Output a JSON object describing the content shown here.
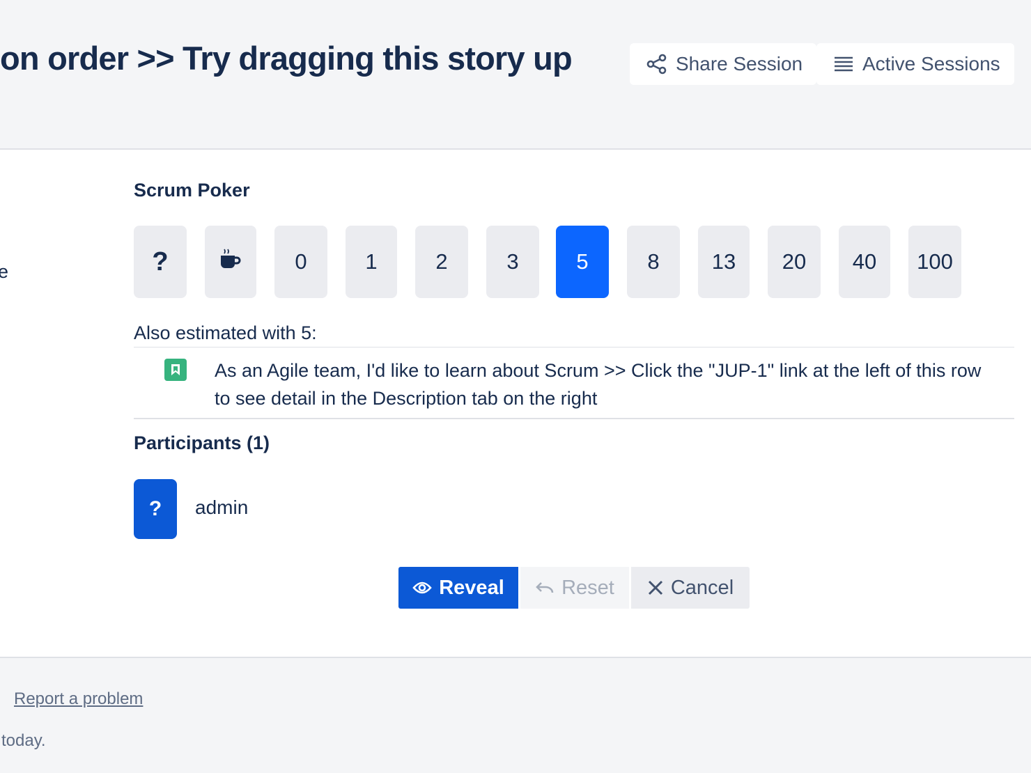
{
  "header": {
    "title": "on order >> Try dragging this story up",
    "share_label": "Share Session",
    "active_label": "Active Sessions"
  },
  "main": {
    "edge_text": "e",
    "poker_title": "Scrum Poker",
    "cards": [
      "?",
      "coffee",
      "0",
      "1",
      "2",
      "3",
      "5",
      "8",
      "13",
      "20",
      "40",
      "100"
    ],
    "selected_card": "5",
    "also_estimated": "Also estimated with 5:",
    "story_text": "As an Agile team, I'd like to learn about Scrum >> Click the \"JUP-1\" link at the left of this row to see detail in the Description tab on the right",
    "participants_title": "Participants (1)",
    "participant_card": "?",
    "participant_name": "admin"
  },
  "actions": {
    "reveal": "Reveal",
    "reset": "Reset",
    "cancel": "Cancel"
  },
  "footer": {
    "report_link": "Report a problem",
    "text": "today."
  },
  "colors": {
    "accent": "#0c66ff",
    "primary_button": "#0c59d6",
    "story_icon": "#36b37e"
  }
}
